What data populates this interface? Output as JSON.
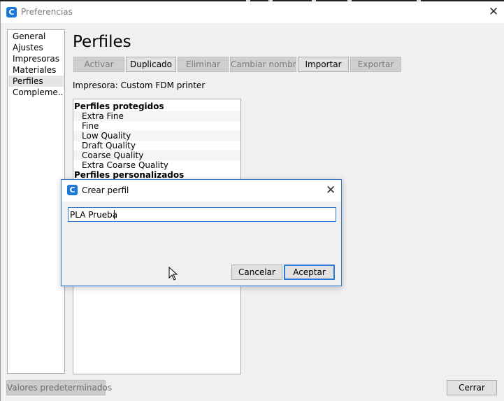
{
  "window": {
    "title": "Preferencias"
  },
  "sidebar": {
    "items": [
      {
        "label": "General"
      },
      {
        "label": "Ajustes"
      },
      {
        "label": "Impresoras"
      },
      {
        "label": "Materiales"
      },
      {
        "label": "Perfiles",
        "selected": true
      },
      {
        "label": "Compleme..."
      }
    ]
  },
  "main": {
    "heading": "Perfiles",
    "toolbar": [
      {
        "label": "Activar",
        "enabled": false
      },
      {
        "label": "Duplicado",
        "enabled": true
      },
      {
        "label": "Eliminar",
        "enabled": false
      },
      {
        "label": "Cambiar nombre",
        "enabled": false
      },
      {
        "label": "Importar",
        "enabled": true
      },
      {
        "label": "Exportar",
        "enabled": false
      }
    ],
    "printer_label": "Impresora: Custom FDM printer",
    "profile_groups": [
      {
        "header": "Perfiles protegidos",
        "items": [
          "Extra Fine",
          "Fine",
          "Low Quality",
          "Draft Quality",
          "Coarse Quality",
          "Extra Coarse Quality"
        ]
      },
      {
        "header": "Perfiles personalizados",
        "items": []
      }
    ]
  },
  "footer": {
    "reset_label": "Valores predeterminados",
    "close_label": "Cerrar"
  },
  "dialog": {
    "title": "Crear perfil",
    "input_value": "PLA Prueba",
    "cancel_label": "Cancelar",
    "accept_label": "Aceptar"
  },
  "icons": {
    "app": "cura-logo-icon",
    "close": "close-icon",
    "cursor": "mouse-pointer-icon"
  },
  "colors": {
    "accent": "#2c7ad6",
    "app_icon": "#1a78d6"
  }
}
